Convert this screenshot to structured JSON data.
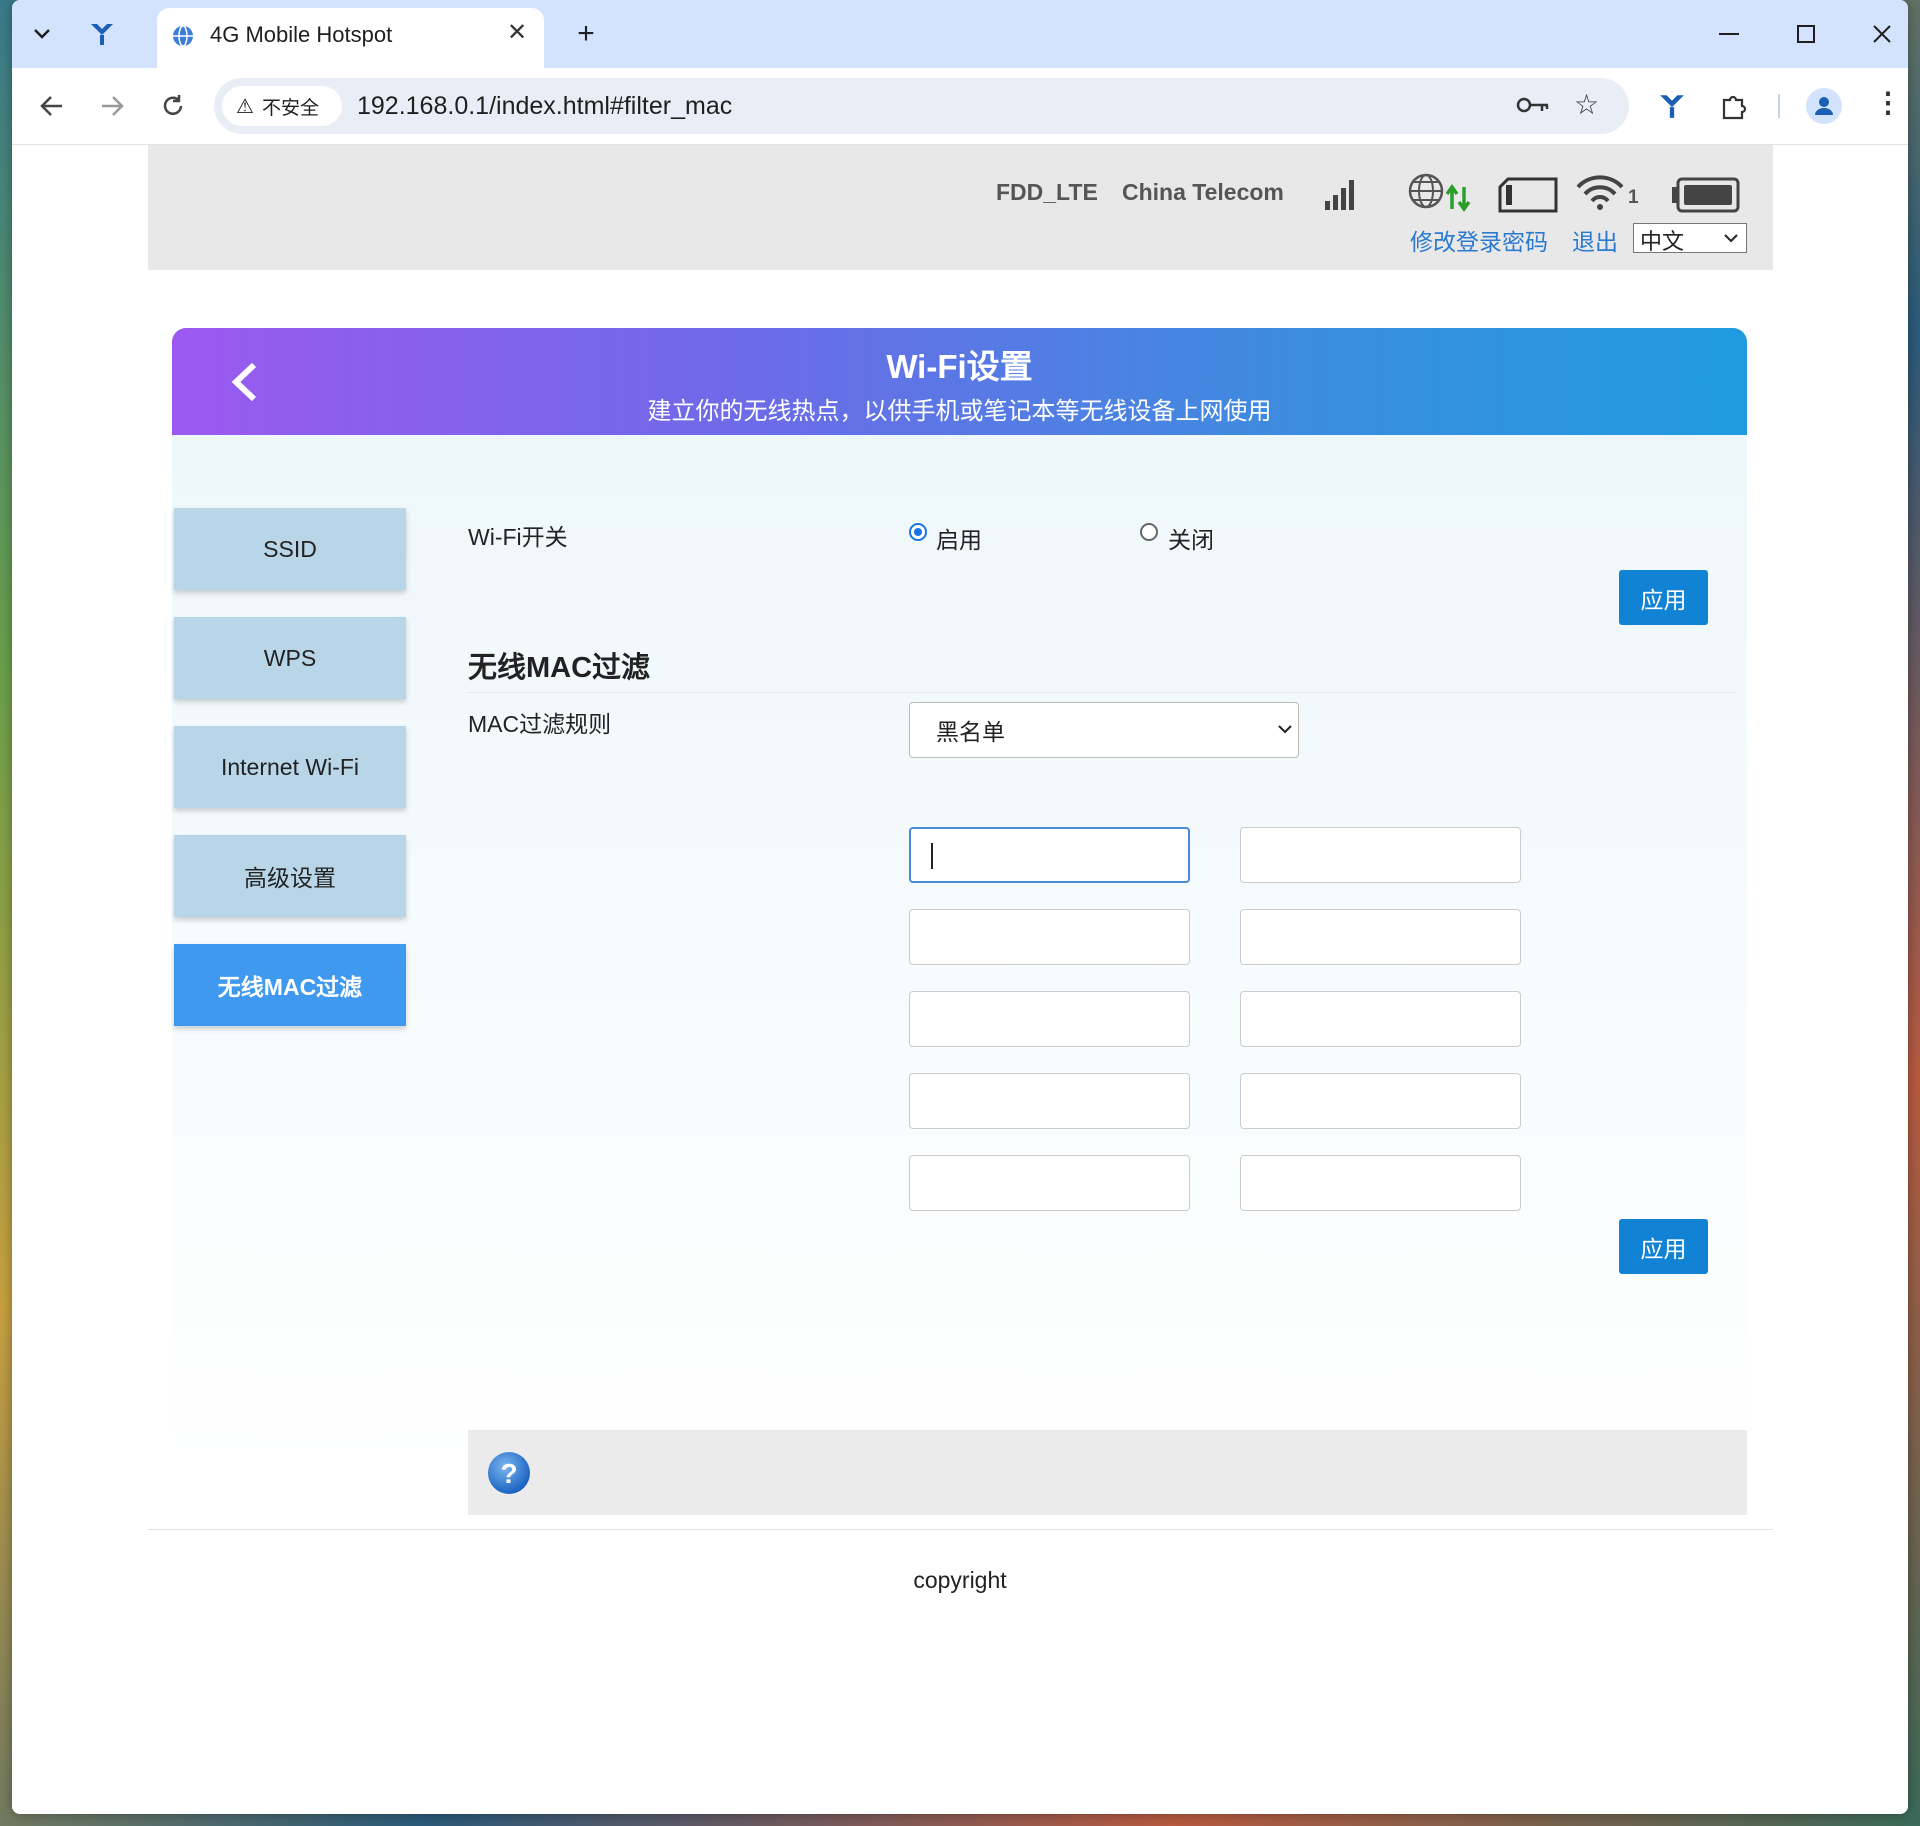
{
  "browser": {
    "tab_title": "4G Mobile Hotspot",
    "security_label": "不安全",
    "url": "192.168.0.1/index.html#filter_mac"
  },
  "status_bar": {
    "network_type": "FDD_LTE",
    "carrier": "China Telecom",
    "wifi_clients": "1",
    "change_password_link": "修改登录密码",
    "logout_link": "退出",
    "language": "中文"
  },
  "banner": {
    "title": "Wi-Fi设置",
    "subtitle": "建立你的无线热点，以供手机或笔记本等无线设备上网使用"
  },
  "sidebar": {
    "items": [
      {
        "label": "SSID",
        "active": false
      },
      {
        "label": "WPS",
        "active": false
      },
      {
        "label": "Internet Wi-Fi",
        "active": false
      },
      {
        "label": "高级设置",
        "active": false
      },
      {
        "label": "无线MAC过滤",
        "active": true
      }
    ]
  },
  "wifi_switch": {
    "label": "Wi-Fi开关",
    "option_on": "启用",
    "option_off": "关闭",
    "selected": "启用",
    "apply_label": "应用"
  },
  "mac_filter": {
    "section_title": "无线MAC过滤",
    "rule_label": "MAC过滤规则",
    "rule_value": "黑名单",
    "entries": [
      "",
      "",
      "",
      "",
      "",
      "",
      "",
      "",
      "",
      ""
    ],
    "apply_label": "应用"
  },
  "footer": {
    "copyright": "copyright"
  },
  "colors": {
    "accent": "#1282d4",
    "sidebar_active": "#3f99ee",
    "sidebar_inactive": "#b8d6e8",
    "link": "#2a7ad0"
  }
}
